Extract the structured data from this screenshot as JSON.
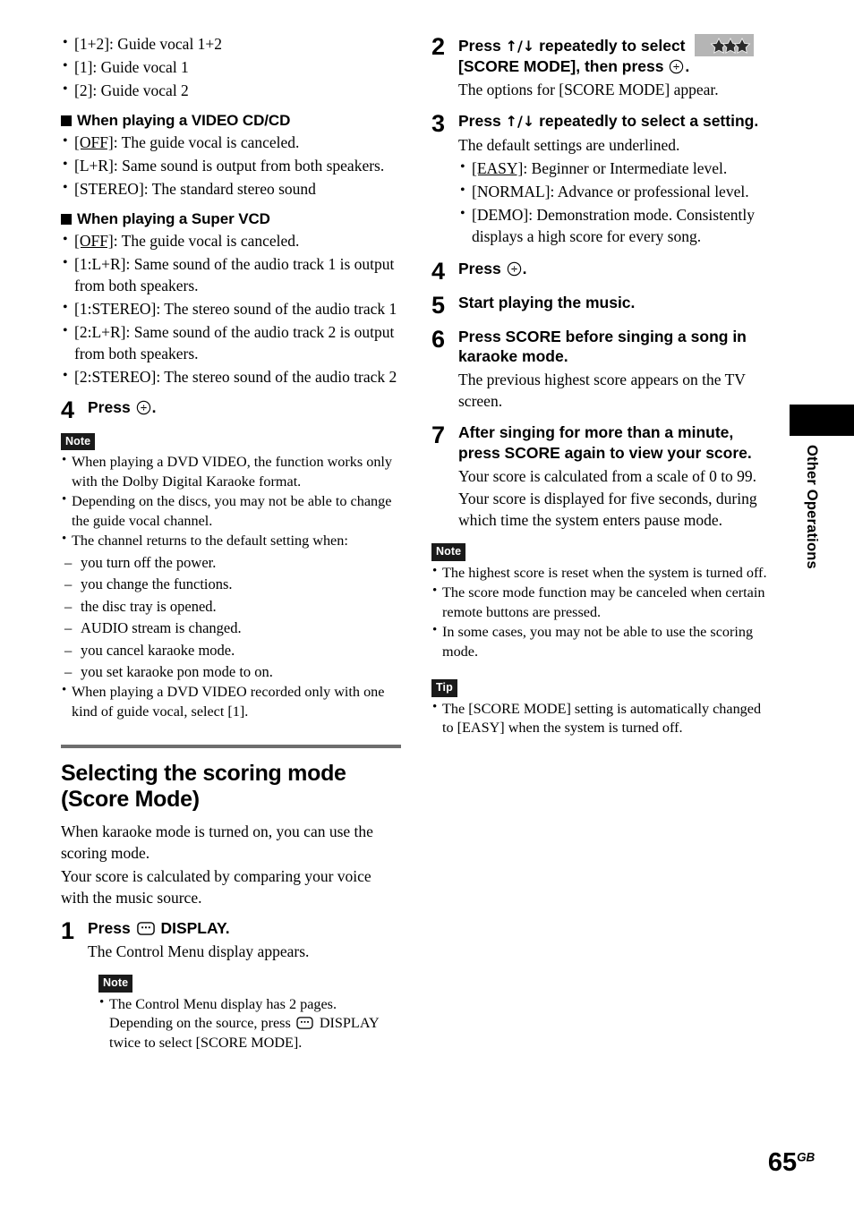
{
  "page": {
    "number": "65",
    "region_suffix": "GB",
    "edge_tab_label": "Other Operations"
  },
  "icons": {
    "enter": "enter-button-icon",
    "display": "display-button-icon",
    "score_mode": "score-mode-stars-icon",
    "arrows_up_down": "↑/↓"
  },
  "colors": {
    "rule": "#6e6e6e",
    "badge_bg": "#1a1a1a",
    "badge_fg": "#ffffff",
    "score_icon_bg": "#b5b5b5",
    "tab_black": "#000000"
  },
  "left_column": {
    "vocal_options": [
      "[1+2]: Guide vocal 1+2",
      "[1]: Guide vocal 1",
      "[2]: Guide vocal 2"
    ],
    "videocd_heading": "When playing a VIDEO CD/CD",
    "videocd_options": [
      {
        "key": "[OFF]",
        "underline": true,
        "text": ": The guide vocal is canceled."
      },
      {
        "key": "[L+R]",
        "underline": false,
        "text": ": Same sound is output from both speakers."
      },
      {
        "key": "[STEREO]",
        "underline": false,
        "text": ": The standard stereo sound"
      }
    ],
    "svcd_heading": "When playing a Super VCD",
    "svcd_options": [
      {
        "key": "[OFF]",
        "underline": true,
        "text": ": The guide vocal is canceled."
      },
      {
        "key": "[1:L+R]",
        "underline": false,
        "text": ": Same sound of the audio track 1 is output from both speakers."
      },
      {
        "key": "[1:STEREO]",
        "underline": false,
        "text": ": The stereo sound of the audio track 1"
      },
      {
        "key": "[2:L+R]",
        "underline": false,
        "text": ": Same sound of the audio track 2 is output from both speakers."
      },
      {
        "key": "[2:STEREO]",
        "underline": false,
        "text": ": The stereo sound of the audio track 2"
      }
    ],
    "step4": {
      "number": "4",
      "title_before": "Press",
      "title_after": "."
    },
    "note1": {
      "badge": "Note",
      "items": [
        "When playing a DVD VIDEO, the function works only with the Dolby Digital Karaoke format.",
        "Depending on the discs, you may not be able to change the guide vocal channel.",
        "The channel returns to the default setting when:"
      ],
      "sub_items": [
        "you turn off the power.",
        "you change the functions.",
        "the disc tray is opened.",
        "AUDIO stream is changed.",
        "you cancel karaoke mode.",
        "you set karaoke pon mode to on."
      ],
      "last_item": "When playing a DVD VIDEO recorded only with one kind of guide vocal, select [1]."
    },
    "section": {
      "heading_line1": "Selecting the scoring mode",
      "heading_line2": "(Score Mode)",
      "intro_p1": "When karaoke mode is turned on, you can use the scoring mode.",
      "intro_p2": "Your score is calculated by comparing your voice with the music source."
    },
    "step1": {
      "number": "1",
      "title_before": "Press",
      "title_after": "DISPLAY.",
      "desc": "The Control Menu display appears."
    },
    "note2": {
      "badge": "Note",
      "item_part1": "The Control Menu display has 2 pages. Depending on the source, press",
      "item_part2": "DISPLAY twice to select [SCORE MODE]."
    }
  },
  "right_column": {
    "step2": {
      "number": "2",
      "title_part1": "Press",
      "title_arrows": "↑/↓",
      "title_part2": "repeatedly to select",
      "title_part3": "[SCORE MODE], then press",
      "title_part4": ".",
      "desc": "The options for [SCORE MODE] appear."
    },
    "step3": {
      "number": "3",
      "title_part1": "Press",
      "title_arrows": "↑/↓",
      "title_part2": "repeatedly to select a setting.",
      "desc": "The default settings are underlined.",
      "options": [
        {
          "key": "[EASY]",
          "underline": true,
          "text": ": Beginner or Intermediate level."
        },
        {
          "key": "[NORMAL]",
          "underline": false,
          "text": ": Advance or professional level."
        },
        {
          "key": "[DEMO]",
          "underline": false,
          "text": ": Demonstration mode. Consistently displays a high score for every song."
        }
      ]
    },
    "step4": {
      "number": "4",
      "title_before": "Press",
      "title_after": "."
    },
    "step5": {
      "number": "5",
      "title": "Start playing the music."
    },
    "step6": {
      "number": "6",
      "title": "Press SCORE before singing a song in karaoke mode.",
      "desc": "The previous highest score appears on the TV screen."
    },
    "step7": {
      "number": "7",
      "title": "After singing for more than a minute, press SCORE again to view your score.",
      "desc1": "Your score is calculated from a scale of 0 to 99.",
      "desc2": "Your score is displayed for five seconds, during which time the system enters pause mode."
    },
    "note": {
      "badge": "Note",
      "items": [
        "The highest score is reset when the system is turned off.",
        "The score mode function may be canceled when certain remote buttons are pressed.",
        "In some cases, you may not be able to use the scoring mode."
      ]
    },
    "tip": {
      "badge": "Tip",
      "items": [
        "The [SCORE MODE] setting is automatically changed to [EASY] when the system is turned off."
      ]
    }
  }
}
